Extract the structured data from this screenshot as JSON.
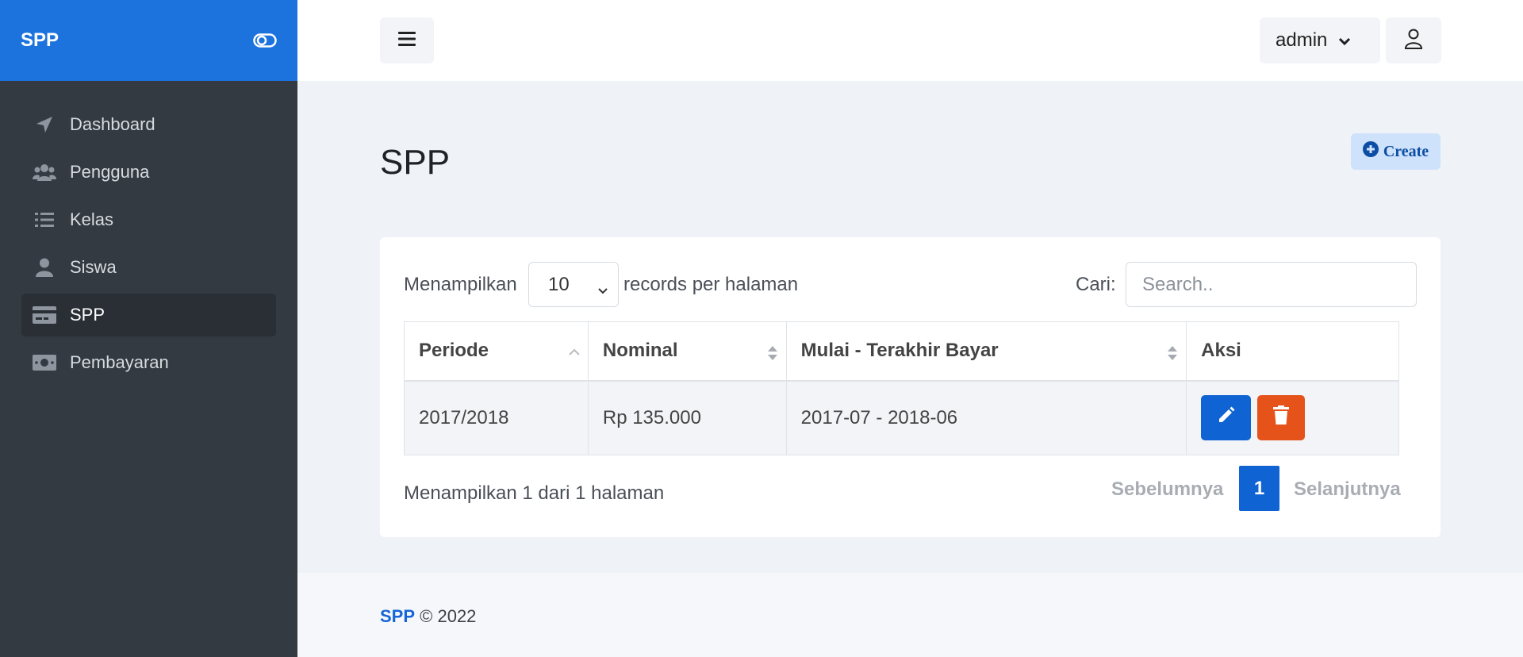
{
  "brand": {
    "title": "SPP",
    "accent": "#1c73dd"
  },
  "sidebar": {
    "items": [
      {
        "label": "Dashboard",
        "icon": "paper-plane-icon",
        "active": false
      },
      {
        "label": "Pengguna",
        "icon": "users-icon",
        "active": false
      },
      {
        "label": "Kelas",
        "icon": "list-icon",
        "active": false
      },
      {
        "label": "Siswa",
        "icon": "user-icon",
        "active": false
      },
      {
        "label": "SPP",
        "icon": "credit-card-icon",
        "active": true
      },
      {
        "label": "Pembayaran",
        "icon": "money-bill-icon",
        "active": false
      }
    ]
  },
  "header": {
    "username": "admin"
  },
  "page": {
    "title": "SPP",
    "create_label": "Create"
  },
  "table_controls": {
    "show_label": "Menampilkan",
    "per_page": "10",
    "records_label": "records per halaman",
    "search_label": "Cari:",
    "search_placeholder": "Search.."
  },
  "table": {
    "columns": [
      "Periode",
      "Nominal",
      "Mulai - Terakhir Bayar",
      "Aksi"
    ],
    "rows": [
      {
        "periode": "2017/2018",
        "nominal": "Rp 135.000",
        "range": "2017-07 - 2018-06"
      }
    ]
  },
  "pagination": {
    "info": "Menampilkan 1 dari 1 halaman",
    "prev": "Sebelumnya",
    "current": "1",
    "next": "Selanjutnya"
  },
  "footer": {
    "brand": "SPP",
    "text": "© 2022"
  },
  "colors": {
    "primary": "#0f63d2",
    "danger": "#e5521a",
    "sidebar_bg": "#343a42"
  }
}
